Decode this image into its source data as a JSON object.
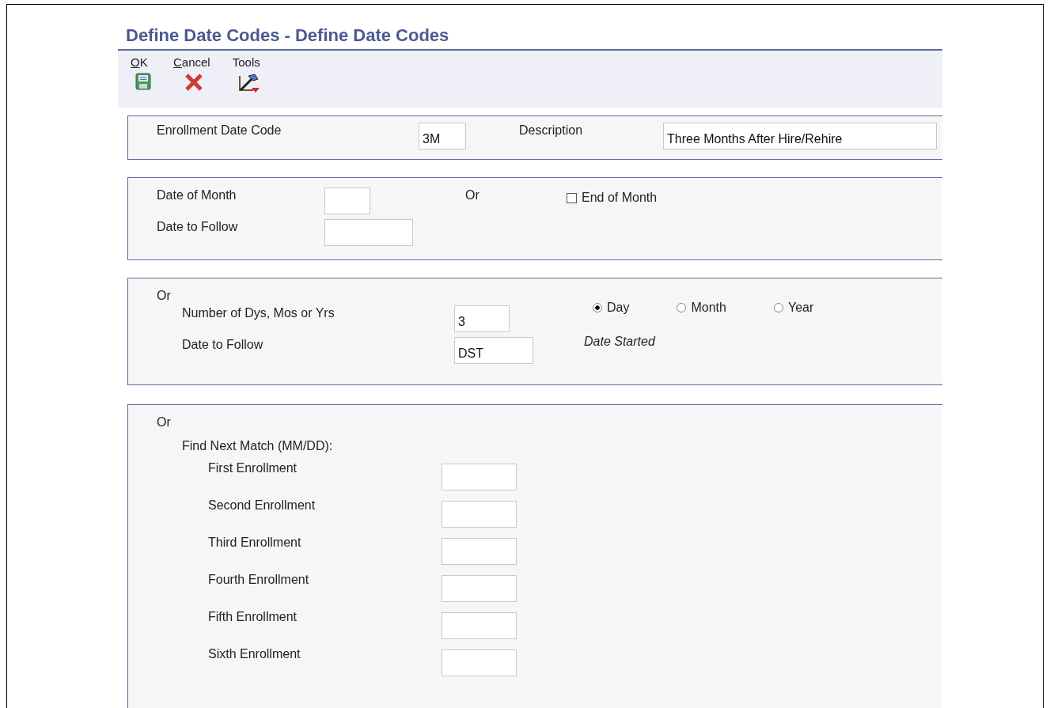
{
  "title": "Define Date Codes - Define Date Codes",
  "toolbar": [
    {
      "label": "OK",
      "kind": "save",
      "underline_first": true
    },
    {
      "label": "Cancel",
      "kind": "cancel",
      "underline_first": true
    },
    {
      "label": "Tools",
      "kind": "tools",
      "underline_first": false
    }
  ],
  "code_panel": {
    "code_label": "Enrollment Date Code",
    "code_value": "3M",
    "description_label": "Description",
    "description_value": "Three Months After Hire/Rehire"
  },
  "month_panel": {
    "date_of_month_label": "Date of Month",
    "or": "Or",
    "end_of_month": {
      "label": "End of Month",
      "checked": false
    },
    "date_to_follow_label": "Date to Follow"
  },
  "period_panel": {
    "or": "Or",
    "number_label": "Number of Dys, Mos or Yrs",
    "number_value": "3",
    "units": [
      {
        "label": "Day",
        "selected": true
      },
      {
        "label": "Month",
        "selected": false
      },
      {
        "label": "Year",
        "selected": false
      }
    ],
    "date_to_follow_label": "Date to Follow",
    "date_to_follow_value": "DST",
    "date_to_follow_description": "Date Started"
  },
  "match_panel": {
    "or": "Or",
    "heading": "Find Next Match (MM/DD):",
    "enrollments": [
      {
        "label": "First Enrollment"
      },
      {
        "label": "Second Enrollment"
      },
      {
        "label": "Third Enrollment"
      },
      {
        "label": "Fourth Enrollment"
      },
      {
        "label": "Fifth Enrollment"
      },
      {
        "label": "Sixth Enrollment"
      }
    ]
  }
}
